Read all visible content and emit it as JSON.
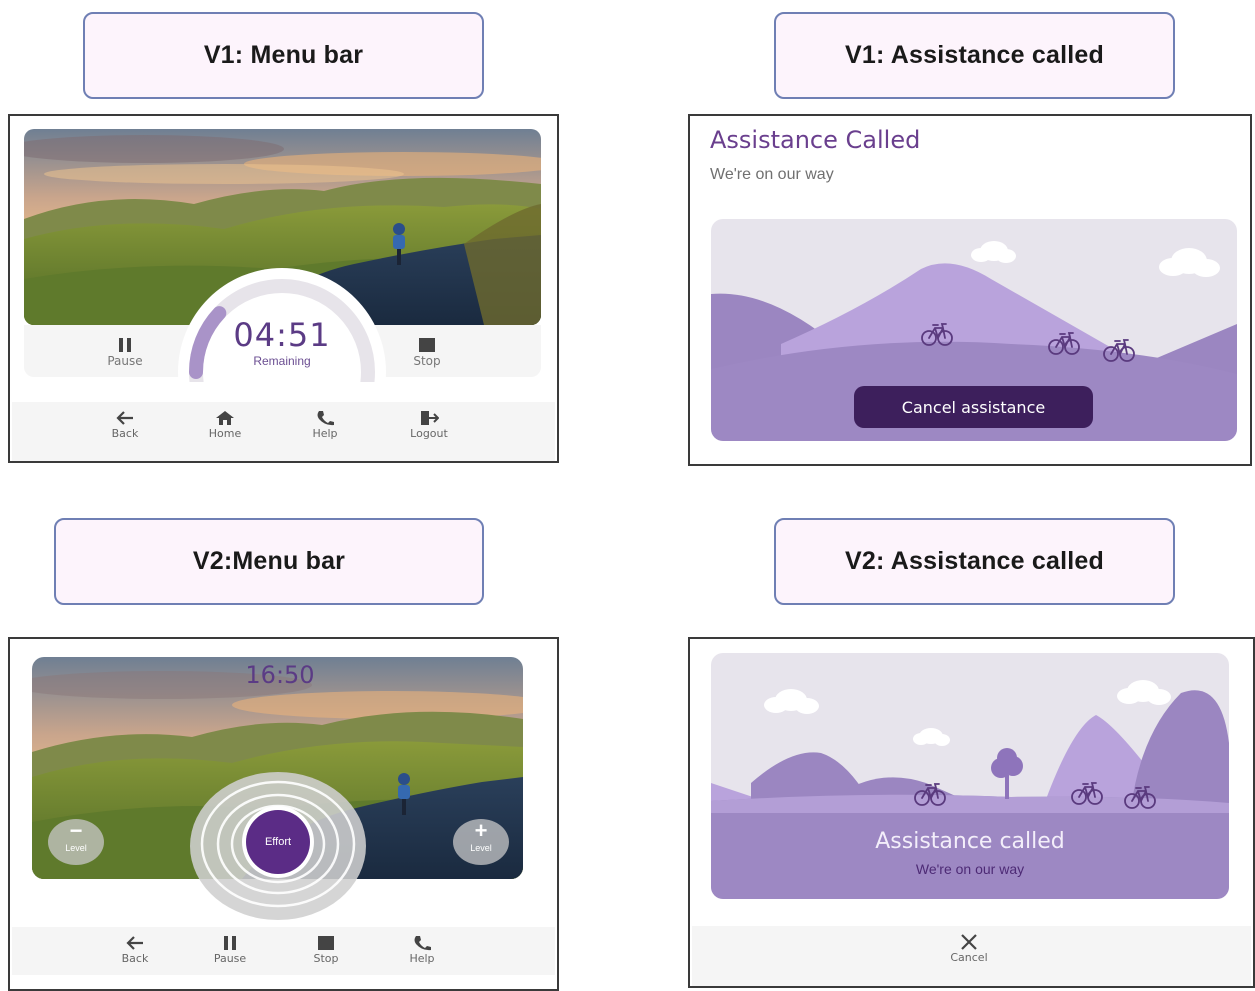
{
  "labels": {
    "v1_menu": "V1: Menu bar",
    "v1_assist": "V1: Assistance called",
    "v2_menu": "V2:Menu bar",
    "v2_assist": "V2: Assistance called"
  },
  "v1_menu": {
    "timer_value": "04:51",
    "timer_label": "Remaining",
    "timer_progress": 0.12,
    "pause_label": "Pause",
    "stop_label": "Stop",
    "nav": [
      {
        "icon": "back-arrow-icon",
        "label": "Back"
      },
      {
        "icon": "home-icon",
        "label": "Home"
      },
      {
        "icon": "phone-icon",
        "label": "Help"
      },
      {
        "icon": "logout-icon",
        "label": "Logout"
      }
    ]
  },
  "v1_assist": {
    "title": "Assistance Called",
    "subtitle": "We're on our way",
    "cancel_label": "Cancel assistance"
  },
  "v2_menu": {
    "time": "16:50",
    "effort_label": "Effort",
    "level_down_label": "Level",
    "level_up_label": "Level",
    "nav": [
      {
        "icon": "back-arrow-icon",
        "label": "Back"
      },
      {
        "icon": "pause-icon",
        "label": "Pause"
      },
      {
        "icon": "stop-icon",
        "label": "Stop"
      },
      {
        "icon": "phone-icon",
        "label": "Help"
      }
    ]
  },
  "v2_assist": {
    "title": "Assistance called",
    "subtitle": "We're on our way",
    "cancel_label": "Cancel"
  },
  "colors": {
    "accent_purple": "#5e2f86",
    "dark_purple_button": "#3d1f5c",
    "landscape_light": "#b9a0da",
    "landscape_mid": "#9c85c2",
    "sky": "#e6e3ec"
  }
}
